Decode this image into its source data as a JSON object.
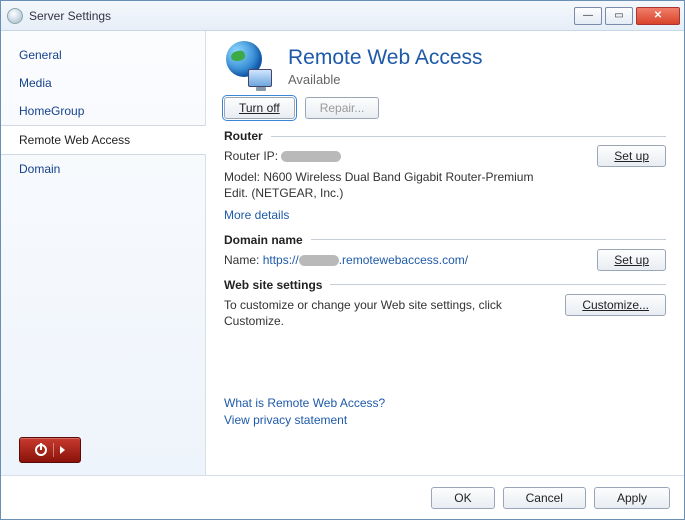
{
  "window": {
    "title": "Server Settings"
  },
  "winbtns": {
    "min": "—",
    "max": "▭",
    "close": "✕"
  },
  "sidebar": {
    "items": [
      {
        "label": "General"
      },
      {
        "label": "Media"
      },
      {
        "label": "HomeGroup"
      },
      {
        "label": "Remote Web Access"
      },
      {
        "label": "Domain"
      }
    ]
  },
  "header": {
    "title": "Remote Web Access",
    "status": "Available"
  },
  "actions": {
    "turnoff": "Turn off",
    "repair": "Repair..."
  },
  "router": {
    "section": "Router",
    "ip_label": "Router IP:",
    "model_label": "Model:",
    "model_value": "N600 Wireless Dual Band Gigabit Router-Premium Edit. (NETGEAR, Inc.)",
    "more": "More details",
    "setup": "Set up"
  },
  "domain": {
    "section": "Domain name",
    "name_label": "Name:",
    "url_prefix": "https://",
    "url_suffix": ".remotewebaccess.com/",
    "setup": "Set up"
  },
  "web": {
    "section": "Web site settings",
    "desc": "To customize or change your Web site settings, click Customize.",
    "customize": "Customize..."
  },
  "help": {
    "what": "What is Remote Web Access?",
    "privacy": "View privacy statement"
  },
  "footer": {
    "ok": "OK",
    "cancel": "Cancel",
    "apply": "Apply"
  }
}
